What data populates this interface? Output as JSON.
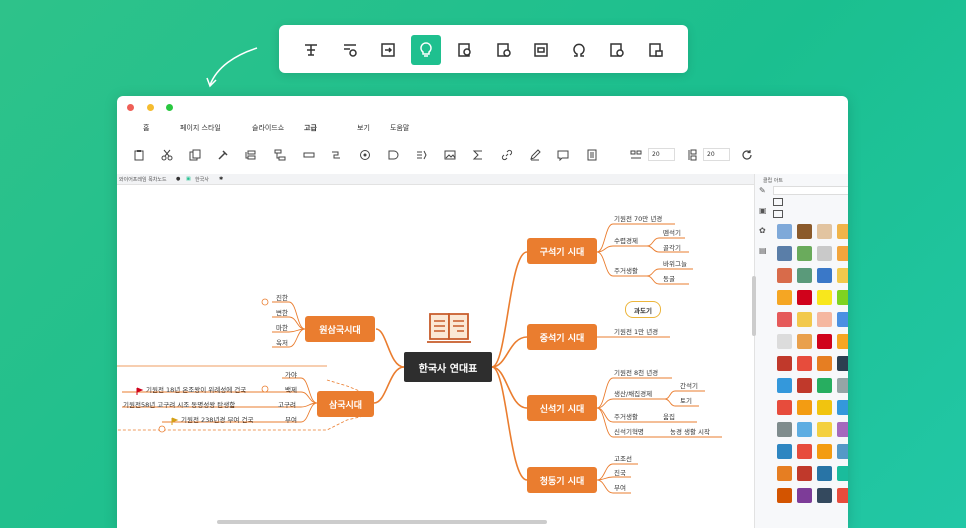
{
  "floating_toolbar": {
    "icons": [
      "layout-tree-icon",
      "layout-settings-icon",
      "export-icon",
      "idea-bulb-icon",
      "search-doc-icon",
      "check-doc-icon",
      "center-frame-icon",
      "omega-icon",
      "clock-doc-icon",
      "lock-doc-icon"
    ],
    "active_index": 3,
    "accent": "#1fc08f"
  },
  "menu": {
    "items": [
      "홈",
      "페이지 스타일",
      "슬라이드쇼",
      "고급",
      "보기",
      "도움말"
    ],
    "active": "고급"
  },
  "toolbar": {
    "spacing_h": "20",
    "spacing_v": "20"
  },
  "tabs": [
    {
      "label": "와이어프레임 목차노드"
    },
    {
      "label": "한국사"
    }
  ],
  "sidepanel": {
    "title": "클립 아트"
  },
  "mindmap": {
    "root": "한국사 연대표",
    "eras": {
      "stone": {
        "label": "구석기 시대",
        "leaves": [
          "기원전 70만 년경",
          "수렵경제",
          "뗀석기",
          "골각기",
          "주거생활",
          "바위그늘",
          "동굴"
        ]
      },
      "middle": {
        "label": "중석기 시대",
        "callout": "과도기",
        "leaves": [
          "기원전 1만 년경"
        ]
      },
      "neo": {
        "label": "신석기 시대",
        "leaves": [
          "기원전 8천 년경",
          "생산/채집경제",
          "간석기",
          "토기",
          "주거생활",
          "움집",
          "신석기혁명",
          "농경 생활 시작"
        ]
      },
      "bronze": {
        "label": "청동기 시대",
        "leaves": [
          "고조선",
          "진국",
          "부여"
        ]
      },
      "wonsam": {
        "label": "원삼국시대",
        "leaves": [
          "진한",
          "변한",
          "마한",
          "옥저"
        ]
      },
      "samguk": {
        "label": "삼국시대",
        "leaves": [
          "가야",
          "기원전 18년 온조왕이 위례성에 건국",
          "백제",
          "기원전58년 고구려 시조 동명성왕 탄생함",
          "고구려",
          "기원전 238년경 부여 건국",
          "부여"
        ]
      }
    },
    "colors": {
      "branch": "#ea7d2f",
      "root": "#2e2e2e"
    }
  }
}
